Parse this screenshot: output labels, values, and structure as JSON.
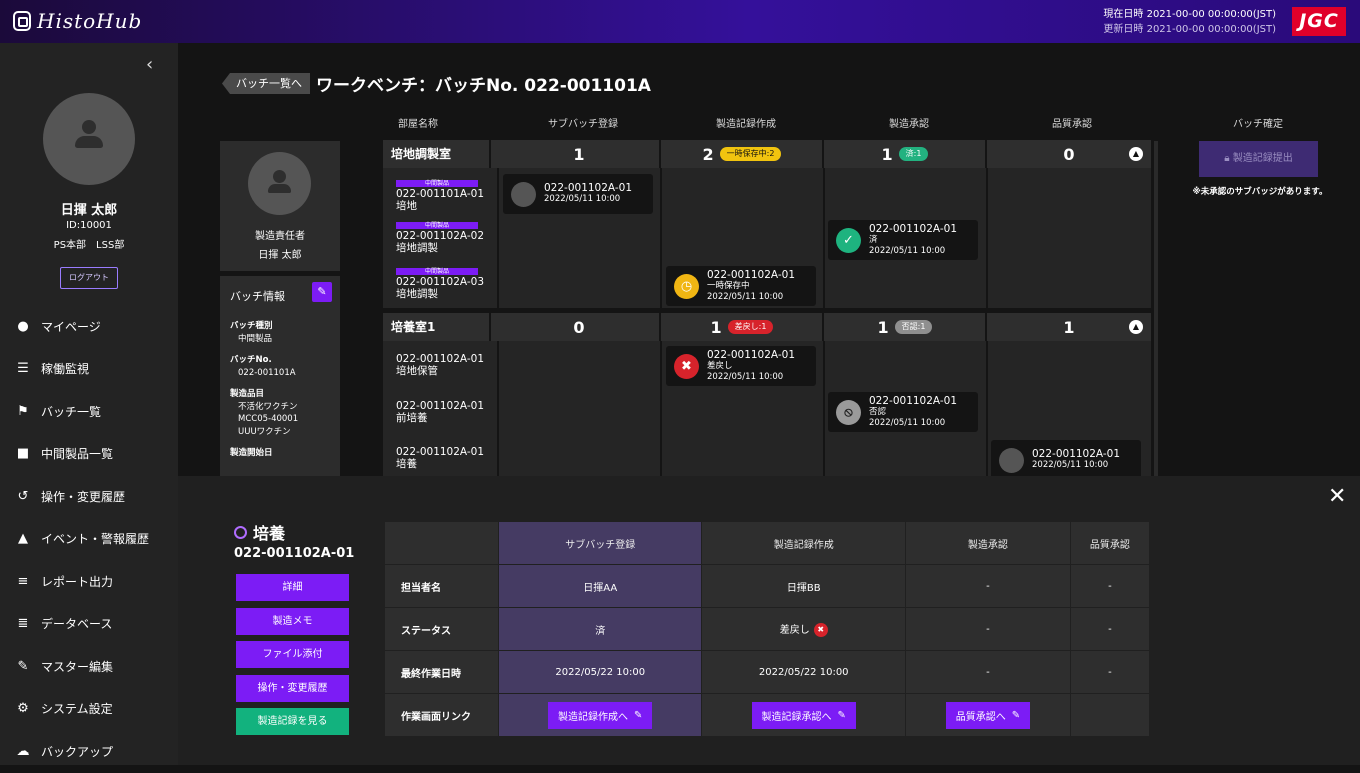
{
  "app": {
    "logo_text": "HistoHub",
    "brand": "JGC"
  },
  "header": {
    "current_time": "現在日時 2021-00-00  00:00:00(JST)",
    "updated_time": "更新日時 2021-00-00  00:00:00(JST)"
  },
  "user": {
    "name": "日揮 太郎",
    "id": "ID:10001",
    "dept": "PS本部　LSS部",
    "logout": "ログアウト"
  },
  "nav": [
    {
      "label": "マイページ",
      "icon": "person-icon"
    },
    {
      "label": "稼働監視",
      "icon": "list-icon"
    },
    {
      "label": "バッチ一覧",
      "icon": "flag-icon"
    },
    {
      "label": "中間製品一覧",
      "icon": "bottle-icon"
    },
    {
      "label": "操作・変更履歴",
      "icon": "history-icon"
    },
    {
      "label": "イベント・警報履歴",
      "icon": "warning-icon"
    },
    {
      "label": "レポート出力",
      "icon": "report-icon"
    },
    {
      "label": "データベース",
      "icon": "database-icon"
    },
    {
      "label": "マスター編集",
      "icon": "pencil-icon"
    },
    {
      "label": "システム設定",
      "icon": "gear-icon"
    },
    {
      "label": "バックアップ",
      "icon": "cloud-upload-icon"
    }
  ],
  "page": {
    "back_label": "バッチ一覧へ",
    "title": "ワークベンチ：バッチNo. 022-001101A"
  },
  "manager": {
    "role": "製造責任者",
    "name": "日揮 太郎"
  },
  "batch_info": {
    "title": "バッチ情報",
    "type_label": "バッチ種別",
    "type_value": "中間製品",
    "no_label": "バッチNo.",
    "no_value": "022-001101A",
    "product_label": "製造品目",
    "product_values": [
      "不活化ワクチン",
      "MCC05-40001",
      "UUUワクチン"
    ],
    "start_label": "製造開始日"
  },
  "columns": {
    "room": "部屋名称",
    "sub": "サブバッチ登録",
    "record": "製造記録作成",
    "approve": "製造承認",
    "quality": "品質承認",
    "confirm": "バッチ確定"
  },
  "rooms": [
    {
      "name": "培地調製室",
      "counts": [
        "1",
        "2",
        "1",
        "0"
      ],
      "badges": {
        "record": "一時保存中:2",
        "approve": "済:1"
      },
      "items": [
        {
          "tag": "中間製品",
          "id": "022-001101A-01",
          "name": "培地"
        },
        {
          "tag": "中間製品",
          "id": "022-001102A-02",
          "name": "培地調製"
        },
        {
          "tag": "中間製品",
          "id": "022-001102A-03",
          "name": "培地調製"
        }
      ],
      "cards": {
        "sub": {
          "id": "022-001102A-01",
          "date": "2022/05/11 10:00"
        },
        "approve": {
          "id": "022-001102A-01",
          "status": "済",
          "date": "2022/05/11 10:00"
        },
        "record": {
          "id": "022-001102A-01",
          "status": "一時保存中",
          "date": "2022/05/11 10:00"
        }
      }
    },
    {
      "name": "培養室1",
      "counts": [
        "0",
        "1",
        "1",
        "1"
      ],
      "badges": {
        "record": "差戻し:1",
        "approve": "否認:1"
      },
      "items": [
        {
          "id": "022-001102A-01",
          "name": "培地保管"
        },
        {
          "id": "022-001102A-01",
          "name": "前培養"
        },
        {
          "id": "022-001102A-01",
          "name": "培養"
        }
      ],
      "cards": {
        "record": {
          "id": "022-001102A-01",
          "status": "差戻し",
          "date": "2022/05/11 10:00"
        },
        "approve": {
          "id": "022-001102A-01",
          "status": "否認",
          "date": "2022/05/11 10:00"
        },
        "quality": {
          "id": "022-001102A-01",
          "date": "2022/05/11 10:00"
        }
      }
    }
  ],
  "confirm": {
    "button": "製造記録提出",
    "warning": "※未承認のサブバッジがあります。"
  },
  "detail": {
    "title": "培養",
    "batch": "022-001102A-01",
    "buttons": [
      "詳細",
      "製造メモ",
      "ファイル添付",
      "操作・変更履歴",
      "製造記録を見る"
    ],
    "headers": [
      "",
      "サブバッチ登録",
      "製造記録作成",
      "製造承認",
      "品質承認"
    ],
    "rows": {
      "owner": {
        "label": "担当者名",
        "values": [
          "日揮AA",
          "日揮BB",
          "-",
          "-"
        ]
      },
      "status": {
        "label": "ステータス",
        "values": [
          "済",
          "差戻し",
          "-",
          "-"
        ]
      },
      "date": {
        "label": "最終作業日時",
        "values": [
          "2022/05/22 10:00",
          "2022/05/22 10:00",
          "-",
          "-"
        ]
      },
      "link": {
        "label": "作業画面リンク",
        "values": [
          "製造記録作成へ",
          "製造記録承認へ",
          "品質承認へ"
        ]
      }
    }
  }
}
